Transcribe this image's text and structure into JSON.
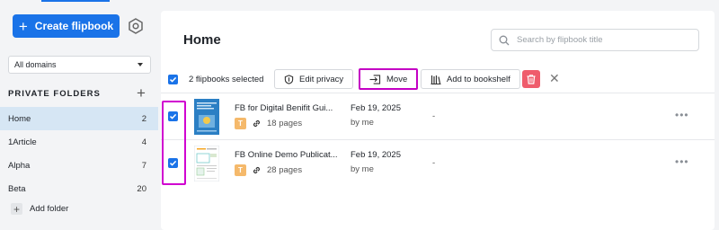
{
  "sidebar": {
    "create_label": "Create flipbook",
    "domain_select": "All domains",
    "folders_heading": "PRIVATE FOLDERS",
    "folders": [
      {
        "name": "Home",
        "count": "2"
      },
      {
        "name": "1Article",
        "count": "4"
      },
      {
        "name": "Alpha",
        "count": "7"
      },
      {
        "name": "Beta",
        "count": "20"
      }
    ],
    "add_folder_label": "Add folder"
  },
  "main": {
    "title": "Home",
    "search_placeholder": "Search by flipbook title",
    "toolbar": {
      "selected_text": "2 flipbooks selected",
      "edit_privacy": "Edit privacy",
      "move": "Move",
      "add_to_bookshelf": "Add to bookshelf"
    },
    "flipbooks": [
      {
        "title": "FB for Digital Benifit Gui...",
        "badge": "T",
        "pages": "18 pages",
        "date": "Feb 19, 2025",
        "owner": "by me",
        "extra": "-"
      },
      {
        "title": "FB Online Demo Publicat...",
        "badge": "T",
        "pages": "28 pages",
        "date": "Feb 19, 2025",
        "owner": "by me",
        "extra": "-"
      }
    ]
  },
  "colors": {
    "accent": "#1a73e8",
    "highlight": "#d000d0",
    "delete": "#ef5c6c",
    "active_folder": "#d6e6f4"
  }
}
